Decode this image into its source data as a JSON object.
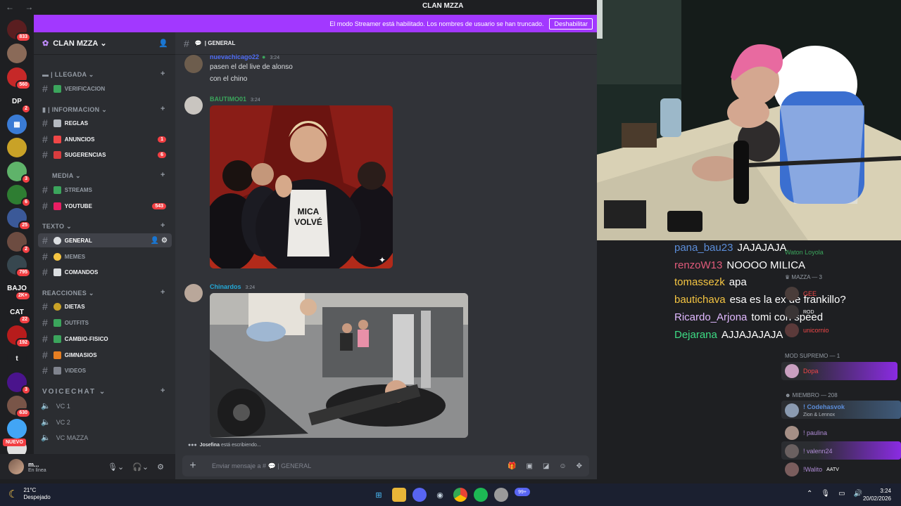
{
  "window": {
    "title": "CLAN MZZA",
    "nav": "← →"
  },
  "rail": {
    "servers": [
      {
        "label": "",
        "badge": "833",
        "color": "#5a1e20"
      },
      {
        "label": "",
        "badge": "",
        "color": "#8a6a58"
      },
      {
        "label": "",
        "badge": "560",
        "color": "#c62828"
      },
      {
        "label": "DP",
        "badge": "2",
        "color": "#1e1f22"
      },
      {
        "label": "▦",
        "badge": "",
        "color": "#3a7bd5"
      },
      {
        "label": "",
        "badge": "",
        "color": "#c9a227"
      },
      {
        "label": "",
        "badge": "3",
        "color": "#5fb36a"
      },
      {
        "label": "",
        "badge": "6",
        "color": "#2e7d32"
      },
      {
        "label": "",
        "badge": "25",
        "color": "#3b5998"
      },
      {
        "label": "",
        "badge": "2",
        "color": "#6d4c41"
      },
      {
        "label": "",
        "badge": "795",
        "color": "#37474f"
      },
      {
        "label": "BAJO",
        "badge": "2K+",
        "color": "#1e1f22"
      },
      {
        "label": "CAT",
        "badge": "22",
        "color": "#1e1f22"
      },
      {
        "label": "",
        "badge": "192",
        "color": "#b71c1c"
      },
      {
        "label": "t",
        "badge": "",
        "color": "#1e1f22"
      },
      {
        "label": "",
        "badge": "3",
        "color": "#4a148c"
      },
      {
        "label": "",
        "badge": "630",
        "color": "#795548"
      },
      {
        "label": "",
        "badge": "",
        "color": "#42a5f5"
      },
      {
        "label": "",
        "badge": "",
        "color": "#e0e0e0"
      }
    ],
    "new_label": "NUEVO"
  },
  "banner": {
    "text": "El modo Streamer está habilitado. Los nombres de usuario se han truncado.",
    "button": "Deshabilitar"
  },
  "sidebar": {
    "server_name": "CLAN MZZA",
    "categories": [
      {
        "name": "LLEGADA"
      },
      {
        "name": "INFORMACION"
      },
      {
        "name": "MEDIA"
      },
      {
        "name": "TEXTO"
      },
      {
        "name": "REACCIONES"
      },
      {
        "name": "VOICECHAT"
      }
    ],
    "channels": {
      "verificacion": "VERIFICACION",
      "reglas": "REGLAS",
      "anuncios": "ANUNCIOS",
      "anuncios_count": "1",
      "sugerencias": "SUGERENCIAS",
      "sugerencias_count": "6",
      "streams": "STREAMS",
      "youtube": "YOUTUBE",
      "youtube_count": "543",
      "general": "GENERAL",
      "memes": "MEMES",
      "comandos": "COMANDOS",
      "dietas": "DIETAS",
      "outfits": "OUTFITS",
      "cambio_fisico": "CAMBIO-FISICO",
      "gimnasios": "GIMNASIOS",
      "videos": "VIDEOS"
    },
    "voice": [
      "VC 1",
      "VC 2",
      "VC MAZZA"
    ]
  },
  "user": {
    "name": "m...",
    "status": "En línea"
  },
  "chat": {
    "channel": "GENERAL",
    "messages": [
      {
        "author": "nuevachicago22",
        "time": "3:24",
        "author_color": "#4f6df5",
        "lines": [
          "pasen el del live de alonso",
          "con el chino"
        ]
      },
      {
        "author": "BAUTIMO01",
        "time": "3:24",
        "author_color": "#3ba55c",
        "image_text": "MICA\nVOLVÉ"
      },
      {
        "author": "Chinardos",
        "time": "3:24",
        "author_color": "#23a8d6"
      }
    ],
    "typing_user": "Josefina",
    "typing_suffix": "está escribiendo...",
    "composer_placeholder": "Enviar mensaje a #",
    "composer_channel": "GENERAL"
  },
  "stream_chat": [
    {
      "user": "pana_bau23",
      "text": "JAJAJAJA",
      "color": "#5b8dd9"
    },
    {
      "user": "renzoW13",
      "text": "NOOOO MILICA",
      "color": "#e05a7a"
    },
    {
      "user": "tomassezk",
      "text": "apa",
      "color": "#f5c542"
    },
    {
      "user": "bautichava",
      "text": "esa es la ex de frankillo?",
      "color": "#f5c542"
    },
    {
      "user": "Ricardo_Arjona",
      "text": "tomi con speed",
      "color": "#e0b8ff"
    },
    {
      "user": "Dejarana",
      "text": "AJJAJAJAJA",
      "color": "#3ddc84"
    }
  ],
  "members": {
    "top_user": "Waton Loyola",
    "cat_mazza": "MAZZA — 3",
    "user_gee": "GEE",
    "user_rod": "ROD",
    "user_unicornio": "unicornio",
    "cat_mod": "MOD SUPREMO — 1",
    "user_dopa": "Dopa",
    "cat_miembro": "MIEMBRO — 208",
    "user_codehasvok": "! Codehasvok",
    "user_codehasvok_activity": "Zion & Lennox",
    "user_paulina": "! paulina",
    "user_valenn": "! valenn24",
    "user_walito": "!Walito",
    "user_walito_tag": "AATV"
  },
  "taskbar": {
    "temperature": "21°C",
    "weather": "Despejado",
    "time": "3:24",
    "date": "20/02/2026",
    "badge": "99+"
  }
}
